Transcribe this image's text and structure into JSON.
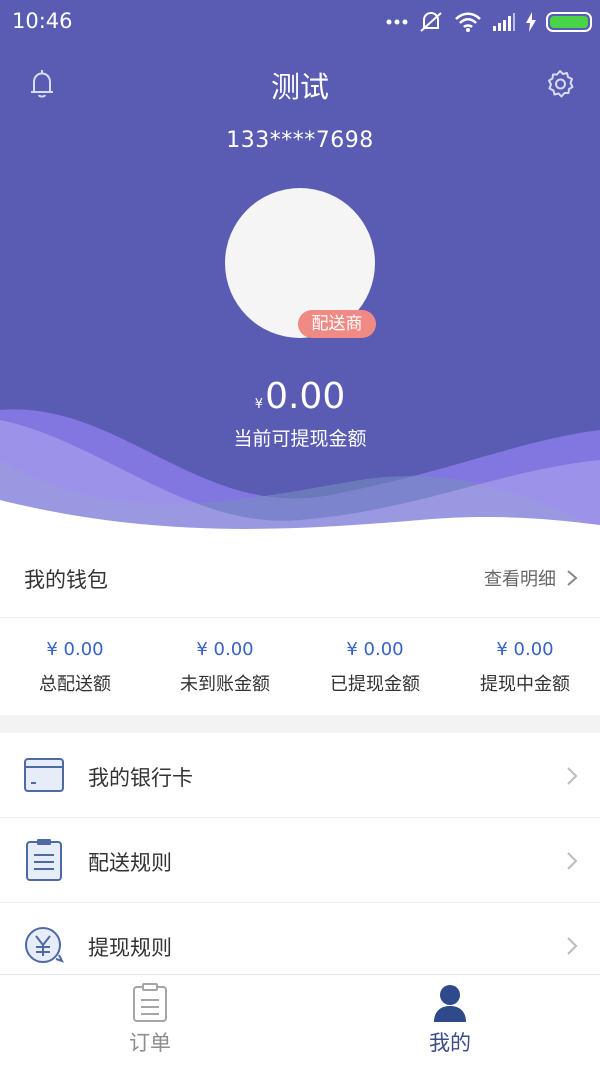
{
  "status_bar": {
    "time": "10:46"
  },
  "header": {
    "title": "测试",
    "phone": "133****7698",
    "role_badge": "配送商",
    "balance_symbol": "¥",
    "balance_amount": "0.00",
    "balance_label": "当前可提现金额"
  },
  "wallet": {
    "title": "我的钱包",
    "detail_link": "查看明细",
    "stats": [
      {
        "value": "¥ 0.00",
        "label": "总配送额"
      },
      {
        "value": "¥ 0.00",
        "label": "未到账金额"
      },
      {
        "value": "¥ 0.00",
        "label": "已提现金额"
      },
      {
        "value": "¥ 0.00",
        "label": "提现中金额"
      }
    ]
  },
  "menu": [
    {
      "label": "我的银行卡",
      "icon": "bank-card-icon"
    },
    {
      "label": "配送规则",
      "icon": "clipboard-list-icon"
    },
    {
      "label": "提现规则",
      "icon": "yen-coin-icon"
    }
  ],
  "bottom_nav": [
    {
      "label": "订单",
      "icon": "order-clipboard-icon",
      "active": false
    },
    {
      "label": "我的",
      "icon": "user-icon",
      "active": true
    }
  ],
  "colors": {
    "header_bg": "#5a5cb3",
    "badge_bg": "#ef8a84",
    "stat_value": "#3a63c7",
    "nav_active": "#3c4b8a"
  }
}
